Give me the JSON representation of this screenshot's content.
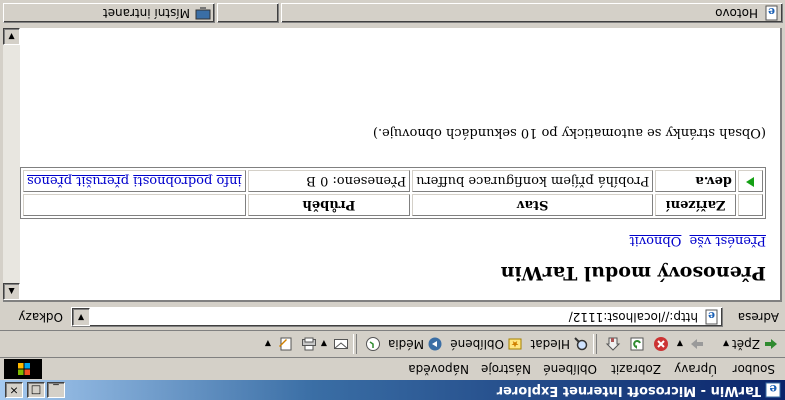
{
  "window": {
    "title": "TarWin - Microsoft Internet Explorer",
    "buttons": {
      "minimize": "_",
      "maximize": "□",
      "close": "×"
    }
  },
  "menu": [
    "Soubor",
    "Úpravy",
    "Zobrazit",
    "Oblíbené",
    "Nástroje",
    "Nápověda"
  ],
  "toolbar": {
    "back": "Zpět",
    "search": "Hledat",
    "favorites": "Oblíbené",
    "media": "Média"
  },
  "address": {
    "label": "Adresa",
    "url": "http://localhost:1112/",
    "links_label": "Odkazy"
  },
  "page": {
    "heading": "Přenosový modul TarWin",
    "actions": [
      "Přenést vše",
      "Obnovit"
    ],
    "table": {
      "headers": [
        "",
        "Zařízení",
        "Stav",
        "Průběh",
        ""
      ],
      "rows": [
        {
          "device": "dev.a",
          "state": "Probíhá příjem konfigurace bufferu",
          "progress": "Přeneseno: 0 B",
          "links": [
            "info",
            "podrobnosti",
            "přerušit přenos"
          ]
        }
      ]
    },
    "note": "(Obsah stránky se automaticky po 10 sekundách obnovuje.)"
  },
  "status": {
    "left": "Hotovo",
    "zone": "Místní intranet"
  },
  "colors": {
    "titlebar_start": "#0a246a",
    "titlebar_end": "#a6caf0",
    "link": "#0000cc",
    "play": "#14a014"
  }
}
